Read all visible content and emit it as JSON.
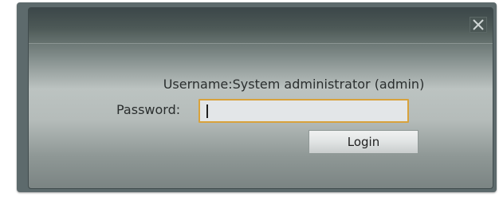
{
  "dialog": {
    "close_icon": "close-icon",
    "username_text": "Username:System administrator (admin)",
    "password_label": "Password:",
    "password_value": "",
    "login_label": "Login"
  },
  "colors": {
    "input_focus_border": "#d8a23c",
    "title_bar": "#3c4749",
    "body_highlight": "#bcc3c1"
  }
}
